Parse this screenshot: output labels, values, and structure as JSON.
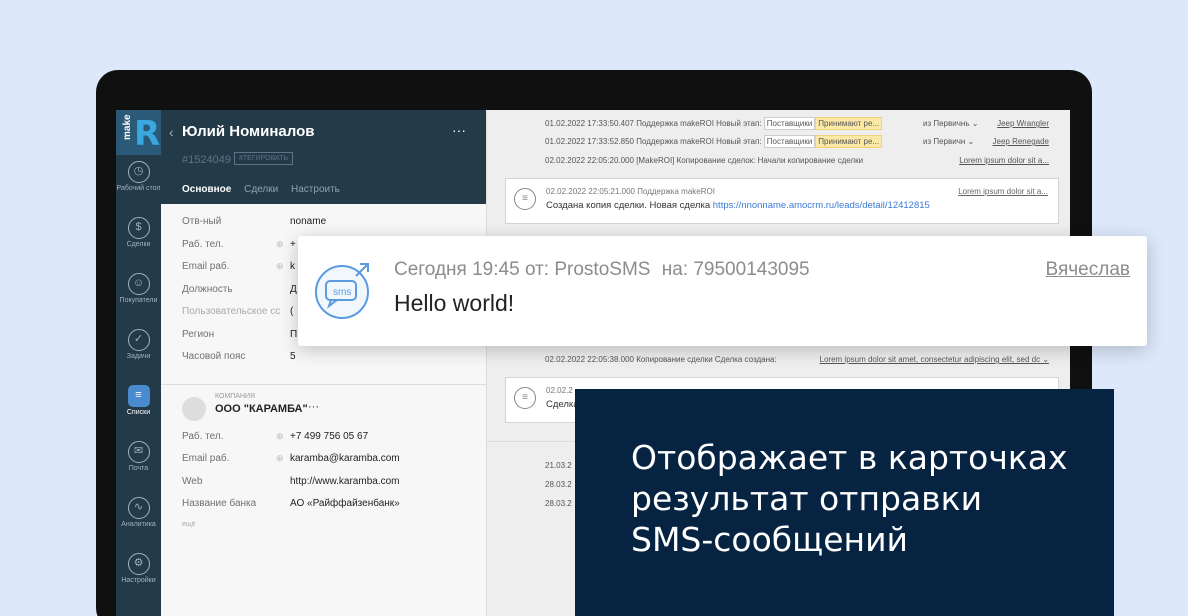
{
  "nav": {
    "items": [
      {
        "label": "Рабочий стол",
        "icon": "dashboard-icon",
        "glyph": "◷"
      },
      {
        "label": "Сделки",
        "icon": "deals-icon",
        "glyph": "$"
      },
      {
        "label": "Покупатели",
        "icon": "customers-icon",
        "glyph": "☺"
      },
      {
        "label": "Задачи",
        "icon": "tasks-icon",
        "glyph": "✓"
      },
      {
        "label": "Списки",
        "icon": "lists-icon",
        "glyph": "≡"
      },
      {
        "label": "Почта",
        "icon": "mail-icon",
        "glyph": "✉"
      },
      {
        "label": "Аналитика",
        "icon": "analytics-icon",
        "glyph": "∿"
      },
      {
        "label": "Настройки",
        "icon": "settings-icon",
        "glyph": "⚙"
      }
    ],
    "logo_text": "make",
    "logo_letter": "R"
  },
  "card": {
    "back": "‹",
    "name": "Юлий Номиналов",
    "more": "···",
    "id": "#1524049",
    "tag_button": "#ТЕГИРОВАТЬ",
    "tabs": [
      "Основное",
      "Сделки",
      "Настроить"
    ],
    "fields": [
      {
        "key": "Отв-ный",
        "value": "noname"
      },
      {
        "key": "Раб. тел.",
        "value": "+"
      },
      {
        "key": "Email раб.",
        "value": "k"
      },
      {
        "key": "Должность",
        "value": "Д"
      },
      {
        "key": "Пользовательское сс",
        "value": "("
      },
      {
        "key": "Регион",
        "value": "П"
      },
      {
        "key": "Часовой пояс",
        "value": "5"
      }
    ],
    "company": {
      "label": "КОМПАНИЯ",
      "name": "ООО \"КАРАМБА\"",
      "more": "···",
      "fields": [
        {
          "key": "Раб. тел.",
          "value": "+7 499 756 05 67"
        },
        {
          "key": "Email раб.",
          "value": "karamba@karamba.com"
        },
        {
          "key": "Web",
          "value": "http://www.karamba.com"
        },
        {
          "key": "Название банка",
          "value": "АО «Райффайзенбанк»"
        }
      ],
      "more_link": "ещё"
    }
  },
  "feed": {
    "line1": {
      "text": "01.02.2022 17:33:50.407 Поддержка makeROI Новый этап:",
      "chip1": "Поставщики",
      "chip2": "Принимают ре...",
      "from": "из Первичнь ⌄",
      "link": "Jeep Wrangler"
    },
    "line2": {
      "text": "01.02.2022 17:33:52.850 Поддержка makeROI Новый этап:",
      "chip1": "Поставщики",
      "chip2": "Принимают ре...",
      "from": "из Первичн ⌄",
      "link": "Jeep Renegade"
    },
    "line3": {
      "text": "02.02.2022 22:05:20.000 [MakeROI] Копирование сделок: Начали копирование сделки",
      "link": "Lorem ipsum dolor sit a..."
    },
    "box1": {
      "meta": "02.02.2022 22:05:21.000 Поддержка makeROI",
      "text": "Создана копия сделки. Новая сделка",
      "url": "https://nnonname.amocrm.ru/leads/detail/12412815",
      "link": "Lorem ipsum dolor sit a..."
    },
    "line4": {
      "text": "02.02.2022 22:05:38.000 Копирование сделки Сделка создана:",
      "link": "Lorem ipsum dolor sit amet, consectetur adipiscing elit, sed dc ⌄"
    },
    "box2": {
      "meta": "02.02.2",
      "text": "Сделка"
    },
    "dates": [
      "21.03.2",
      "28.03.2",
      "28.03.2"
    ]
  },
  "sms": {
    "when": "Сегодня 19:45",
    "from_label": "от:",
    "sender": "ProstoSMS",
    "to_label": "на:",
    "phone": "79500143095",
    "user": "Вячеслав",
    "message": "Hello world!",
    "icon_text": "sms",
    "icon": "sms-icon"
  },
  "promo": {
    "lines": [
      "Отображает в карточках",
      "результат отправки",
      "SMS-сообщений"
    ]
  }
}
